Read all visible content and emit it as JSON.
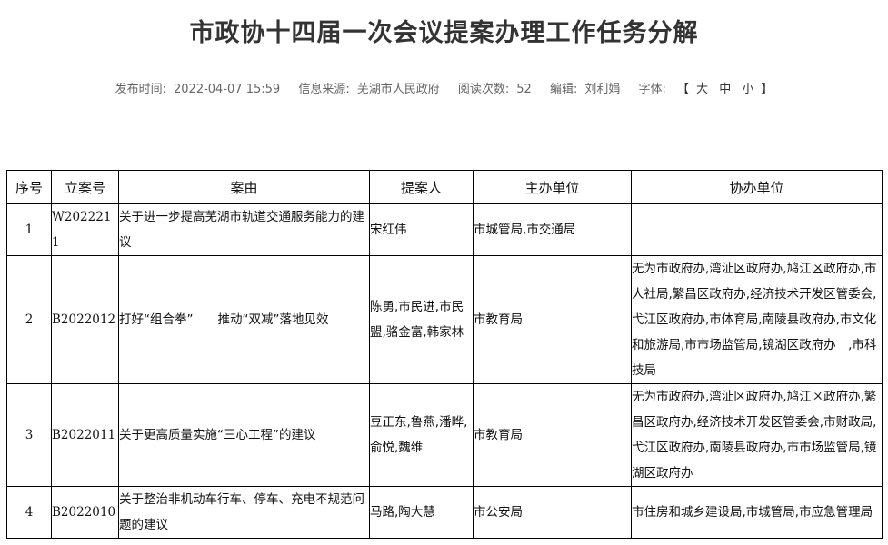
{
  "article": {
    "title": "市政协十四届一次会议提案办理工作任务分解",
    "meta": {
      "publish_time_label": "发布时间:",
      "publish_time": "2022-04-07 15:59",
      "source_label": "信息来源:",
      "source": "芜湖市人民政府",
      "views_label": "阅读次数:",
      "views": "52",
      "editor_label": "编辑:",
      "editor": "刘利娟",
      "font_label": "字体:",
      "bracket_open": "【",
      "font_large": "大",
      "font_medium": "中",
      "font_small": "小",
      "bracket_close": "】"
    }
  },
  "table": {
    "headers": [
      "序号",
      "立案号",
      "案由",
      "提案人",
      "主办单位",
      "协办单位"
    ],
    "rows": [
      {
        "num": "1",
        "id": "W2022211",
        "subject": "关于进一步提高芜湖市轨道交通服务能力的建议",
        "proposer": "宋红伟",
        "host": "市城管局,市交通局",
        "cohost": ""
      },
      {
        "num": "2",
        "id": "B2022012",
        "subject": "打好“组合拳”　　推动“双减”落地见效",
        "proposer": "陈勇,市民进,市民盟,骆金富,韩家林",
        "host": "市教育局",
        "cohost": "无为市政府办,湾沚区政府办,鸠江区政府办,市人社局,繁昌区政府办,经济技术开发区管委会,弋江区政府办,市体育局,南陵县政府办,市文化和旅游局,市市场监管局,镜湖区政府办　,市科技局"
      },
      {
        "num": "3",
        "id": "B2022011",
        "subject": "关于更高质量实施“三心工程”的建议",
        "proposer": "豆正东,鲁燕,潘晔,俞悦,魏维",
        "host": "市教育局",
        "cohost": "无为市政府办,湾沚区政府办,鸠江区政府办,繁昌区政府办,经济技术开发区管委会,市财政局,弋江区政府办,南陵县政府办,市市场监管局,镜湖区政府办"
      },
      {
        "num": "4",
        "id": "B2022010",
        "subject": "关于整治非机动车行车、停车、充电不规范问题的建议",
        "proposer": "马路,陶大慧",
        "host": "市公安局",
        "cohost": "市住房和城乡建设局,市城管局,市应急管理局"
      }
    ]
  }
}
